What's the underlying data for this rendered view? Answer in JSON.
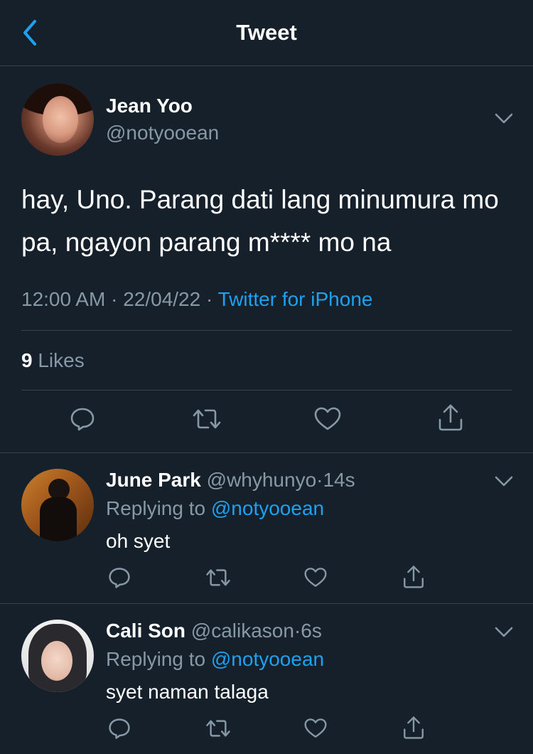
{
  "header": {
    "title": "Tweet"
  },
  "main_tweet": {
    "author_name": "Jean Yoo",
    "author_handle": "@notyooean",
    "text": "hay, Uno. Parang dati lang minumura mo pa, ngayon parang m**** mo na",
    "time": "12:00 AM",
    "date": "22/04/22",
    "separator": "·",
    "source": "Twitter for iPhone",
    "likes_count": "9",
    "likes_label": "Likes"
  },
  "replies": [
    {
      "name": "June Park",
      "handle": "@whyhunyo",
      "dot": "·",
      "time": "14s",
      "replying_label": "Replying to",
      "replying_to": "@notyooean",
      "text": "oh syet"
    },
    {
      "name": "Cali Son",
      "handle": "@calikason",
      "dot": "·",
      "time": "6s",
      "replying_label": "Replying to",
      "replying_to": "@notyooean",
      "text": "syet naman talaga"
    }
  ],
  "icons": [
    "back-icon",
    "chevron-down-icon",
    "reply-icon",
    "retweet-icon",
    "like-icon",
    "share-icon"
  ],
  "colors": {
    "background": "#15202b",
    "accent": "#1da1f2",
    "secondary_text": "#8899a6",
    "border": "#38444d"
  }
}
